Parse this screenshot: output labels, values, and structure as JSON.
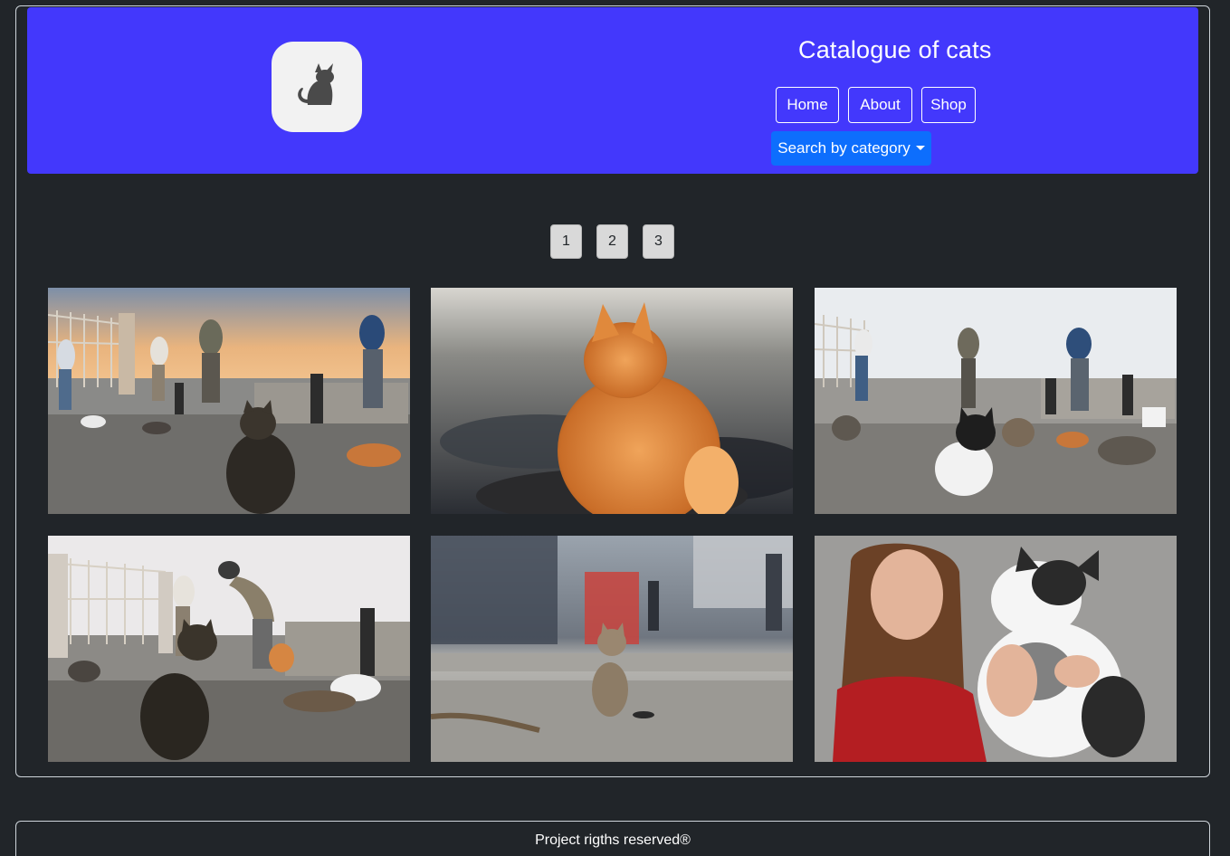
{
  "header": {
    "title": "Catalogue of cats",
    "logo_icon": "cat-icon",
    "nav": [
      {
        "label": "Home"
      },
      {
        "label": "About"
      },
      {
        "label": "Shop"
      }
    ],
    "dropdown_label": "Search by category"
  },
  "pagination": {
    "pages": [
      "1",
      "2",
      "3"
    ]
  },
  "gallery": {
    "images": [
      {
        "subject": "cats-with-fishermen-by-railing-sunset"
      },
      {
        "subject": "orange-cat-on-beach"
      },
      {
        "subject": "black-white-cat-on-pier"
      },
      {
        "subject": "cats-being-fed-on-pier"
      },
      {
        "subject": "tabby-cat-on-street"
      },
      {
        "subject": "woman-holding-black-white-cat"
      }
    ]
  },
  "footer": {
    "text": "Project rigths reserved®"
  },
  "colors": {
    "page_bg": "#212529",
    "header_bg": "#4338fc",
    "dropdown_bg": "#0d6efd",
    "page_button_bg": "#d9d9d9"
  }
}
